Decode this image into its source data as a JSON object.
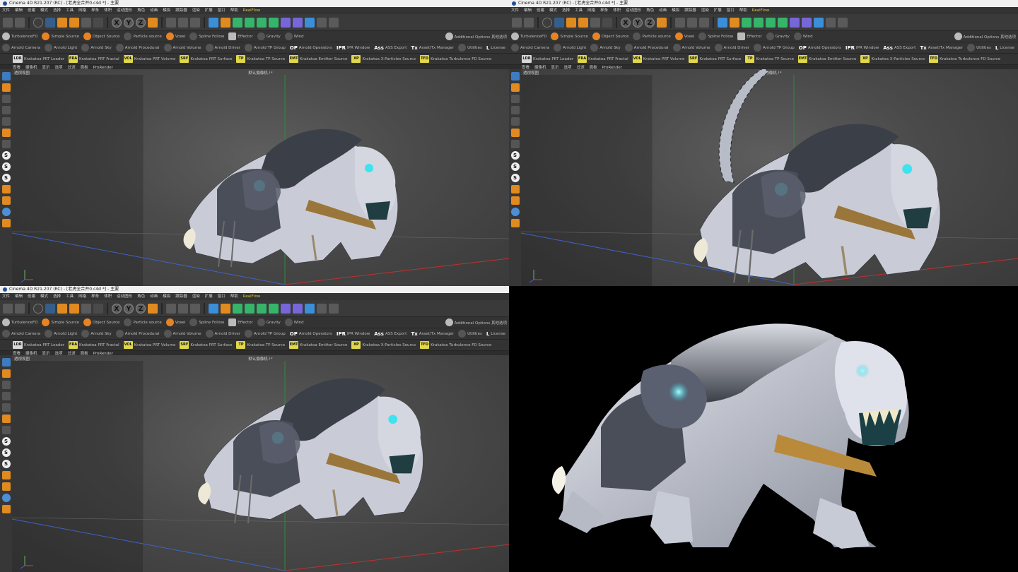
{
  "app": {
    "title_left": "Cinema 4D R21.207 (RC) - [老虎全合并0.c4d *] - 主要",
    "title_right": "Cinema 4D R21.207 (RC) - [老虎全合并0.c4d *] - 主要",
    "title_bottom": "Cinema 4D R21.207 (RC) - [老虎全合并0.c4d *] - 主要"
  },
  "menu": [
    "文件",
    "编辑",
    "创建",
    "模式",
    "选择",
    "工具",
    "网格",
    "样条",
    "体积",
    "运动图形",
    "角色",
    "动画",
    "模拟",
    "跟踪器",
    "渲染",
    "扩展",
    "窗口",
    "帮助",
    "RealFlow"
  ],
  "toolbar": {
    "x_label": "X",
    "y_label": "Y",
    "z_label": "Z"
  },
  "plugin_row1": {
    "items": [
      "TurbulenceFD",
      "Simple Source",
      "Object Source",
      "Particle source",
      "Voxel",
      "Spline Follow",
      "Effector",
      "Gravity",
      "Wind"
    ],
    "right_items": [
      "Additional Options 其他选项"
    ]
  },
  "plugin_row2": {
    "items": [
      "Arnold Camera",
      "Arnold Light",
      "Arnold Sky",
      "Arnold Procedural",
      "Arnold Volume",
      "Arnold Driver",
      "Arnold TP Group",
      "Arnold Operators",
      "IPR Window",
      "ASS Export",
      "Asset/Tx Manager",
      "Utilities",
      "License"
    ],
    "badges": {
      "op": "OP",
      "ipr": "IPR",
      "ass": "Ass",
      "tx": "Tx",
      "l": "L"
    }
  },
  "plugin_row3": {
    "items": [
      "Krakatoa PRT Loader",
      "Krakatoa PRT Fractal",
      "Krakatoa PRT Volume",
      "Krakatoa PRT Surface",
      "Krakatoa TP Source",
      "Krakatoa Emitter Source",
      "Krakatoa X-Particles Source",
      "Krakatoa Turbulence FD Source"
    ],
    "badges": [
      "LDR",
      "FRA",
      "VOL",
      "SRF",
      "TP",
      "EMT",
      "XP",
      "TFD"
    ]
  },
  "viewport_menu": [
    "查看",
    "摄像机",
    "显示",
    "选项",
    "过滤",
    "面板",
    "ProRender"
  ],
  "viewport": {
    "label": "透视视图",
    "camera": "默认摄像机.!*"
  },
  "colors": {
    "accent": "#3b8ed8",
    "bg": "#2f2f2f",
    "orange": "#e08a20",
    "glow": "#35e0f0"
  }
}
